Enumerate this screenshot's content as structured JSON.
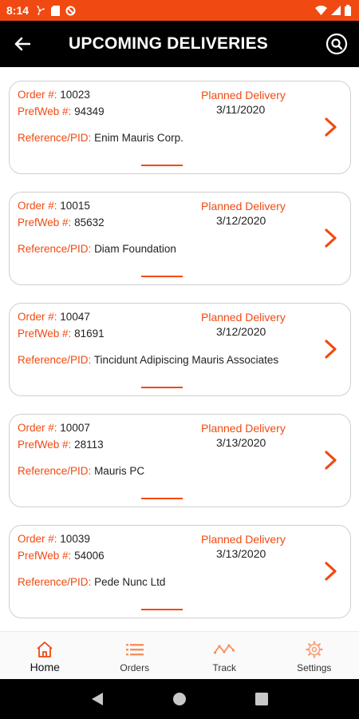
{
  "status_bar": {
    "time": "8:14"
  },
  "app_bar": {
    "title": "UPCOMING DELIVERIES"
  },
  "labels": {
    "order": "Order #:",
    "prefweb": "PrefWeb #:",
    "reference": "Reference/PID:",
    "planned_delivery": "Planned Delivery"
  },
  "deliveries": [
    {
      "order": "10023",
      "prefweb": "94349",
      "reference": "Enim Mauris Corp.",
      "planned_date": "3/11/2020"
    },
    {
      "order": "10015",
      "prefweb": "85632",
      "reference": "Diam Foundation",
      "planned_date": "3/12/2020"
    },
    {
      "order": "10047",
      "prefweb": "81691",
      "reference": "Tincidunt Adipiscing Mauris Associates",
      "planned_date": "3/12/2020"
    },
    {
      "order": "10007",
      "prefweb": "28113",
      "reference": "Mauris PC",
      "planned_date": "3/13/2020"
    },
    {
      "order": "10039",
      "prefweb": "54006",
      "reference": "Pede Nunc Ltd",
      "planned_date": "3/13/2020"
    }
  ],
  "bottom_nav": [
    {
      "label": "Home",
      "icon": "home-icon",
      "active": true
    },
    {
      "label": "Orders",
      "icon": "list-icon",
      "active": false
    },
    {
      "label": "Track",
      "icon": "track-icon",
      "active": false
    },
    {
      "label": "Settings",
      "icon": "gear-icon",
      "active": false
    }
  ],
  "colors": {
    "accent": "#f04a12",
    "app_bar": "#000000",
    "status_bar": "#f04a12"
  }
}
